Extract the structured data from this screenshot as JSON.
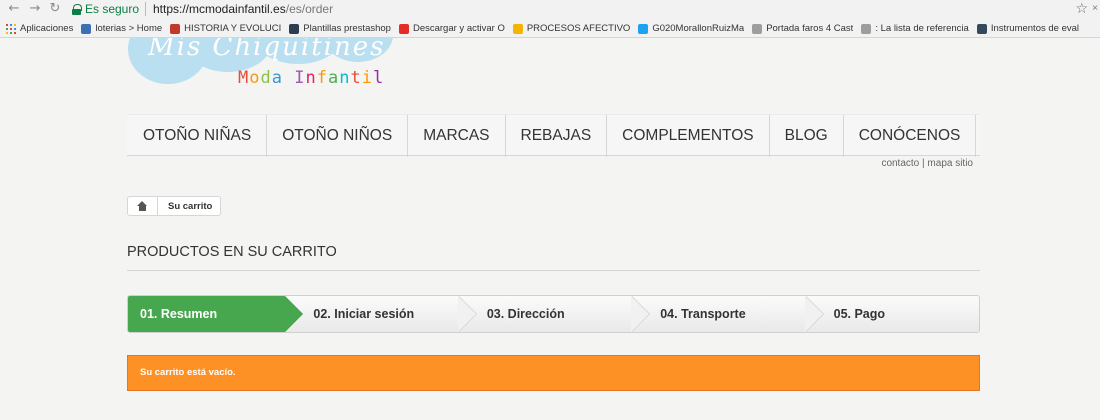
{
  "browser": {
    "secure_label": "Es seguro",
    "url_host": "https://mcmodainfantil.es",
    "url_path": "/es/order",
    "bookmarks": [
      {
        "label": "Aplicaciones",
        "icon": "apps-icon",
        "color": "#4285f4"
      },
      {
        "label": "loterias > Home",
        "icon": "bookmark-icon",
        "color": "#3b6fb6"
      },
      {
        "label": "HISTORIA Y EVOLUCI",
        "icon": "bookmark-icon",
        "color": "#c0392b"
      },
      {
        "label": "Plantillas prestashop",
        "icon": "shield-icon",
        "color": "#2c3e50"
      },
      {
        "label": "Descargar y activar O",
        "icon": "youtube-icon",
        "color": "#e52d27"
      },
      {
        "label": "PROCESOS AFECTIVO",
        "icon": "drive-icon",
        "color": "#f4b400"
      },
      {
        "label": "G020MorallonRuizMa",
        "icon": "twitter-icon",
        "color": "#1da1f2"
      },
      {
        "label": "Portada faros 4 Cast",
        "icon": "page-icon",
        "color": "#9e9e9e"
      },
      {
        "label": ": La lista de referencia",
        "icon": "page-icon",
        "color": "#9e9e9e"
      },
      {
        "label": "Instrumentos de eval",
        "icon": "bookmark-icon",
        "color": "#34495e"
      }
    ]
  },
  "logo": {
    "script_text": "Mis Chiquitines",
    "subtitle": "Moda Infantil",
    "subtitle_colors": [
      "#e74c3c",
      "#f39c12",
      "#8bc34a",
      "#3498db",
      "#9b59b6",
      "#e91e63",
      "#f39c12",
      "#4caf50",
      "#00bcd4",
      "#e74c3c",
      "#ff9800",
      "#9c27b0",
      "#2196f3"
    ]
  },
  "menu": {
    "items": [
      "OTOÑO NIÑAS",
      "OTOÑO NIÑOS",
      "MARCAS",
      "REBAJAS",
      "COMPLEMENTOS",
      "BLOG",
      "CONÓCENOS"
    ]
  },
  "top_links": {
    "contact": "contacto",
    "separator": "|",
    "sitemap": "mapa sitio"
  },
  "breadcrumb": {
    "current": "Su carrito"
  },
  "page": {
    "heading": "PRODUCTOS EN SU CARRITO"
  },
  "steps": [
    {
      "label": "01. Resumen",
      "active": true
    },
    {
      "label": "02. Iniciar sesión",
      "active": false
    },
    {
      "label": "03. Dirección",
      "active": false
    },
    {
      "label": "04. Transporte",
      "active": false
    },
    {
      "label": "05. Pago",
      "active": false
    }
  ],
  "alert": {
    "message": "Su carrito está vacío."
  },
  "colors": {
    "step_active": "#46a74e",
    "alert_bg": "#fe9126"
  }
}
